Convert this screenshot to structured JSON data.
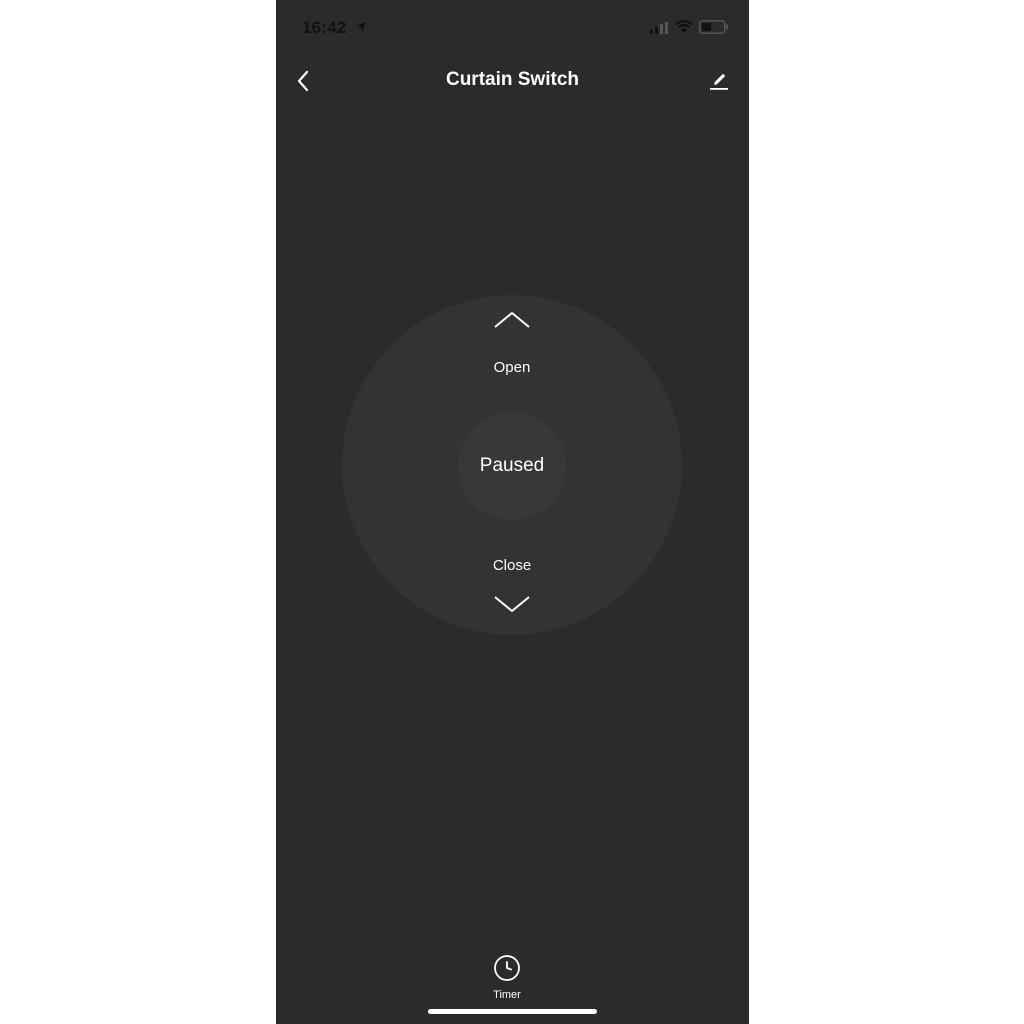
{
  "status_bar": {
    "time": "16:42",
    "icons": [
      "location-arrow-icon",
      "cellular-signal-icon",
      "wifi-icon",
      "battery-icon"
    ]
  },
  "header": {
    "title": "Curtain Switch",
    "back_icon": "chevron-left-icon",
    "edit_icon": "pencil-icon"
  },
  "control": {
    "open_label": "Open",
    "status_label": "Paused",
    "close_label": "Close",
    "open_icon": "chevron-up-icon",
    "close_icon": "chevron-down-icon"
  },
  "footer": {
    "timer_label": "Timer",
    "timer_icon": "clock-icon"
  },
  "colors": {
    "background": "#2b2b2b",
    "dial": "#333333",
    "center_button": "#383838",
    "text": "#ffffff"
  }
}
